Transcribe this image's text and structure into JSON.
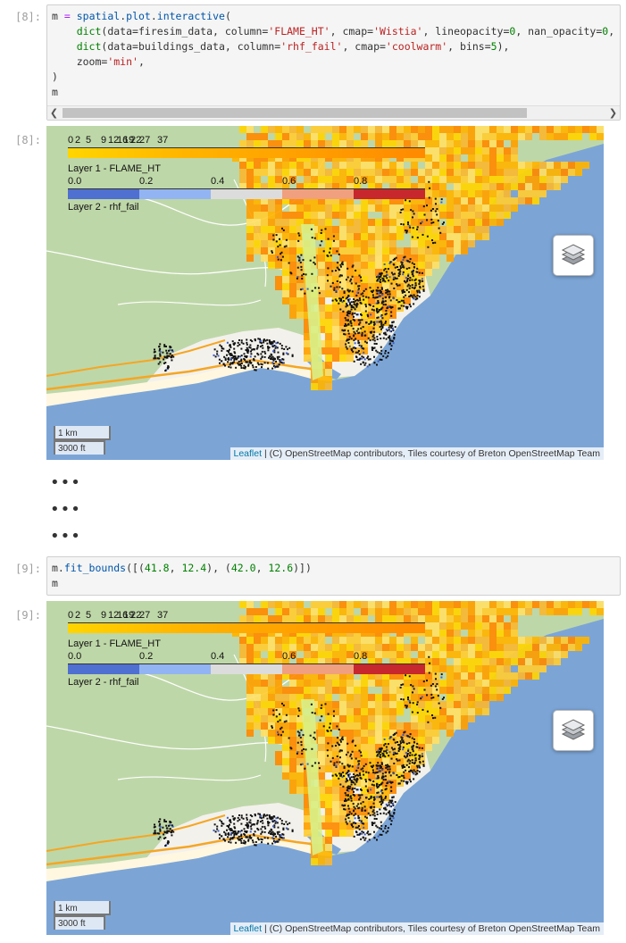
{
  "cell1": {
    "in_prompt": "[8]:",
    "out_prompt": "[8]:",
    "code_lines": [
      "m = spatial.plot.interactive(",
      "    dict(data=firesim_data, column='FLAME_HT', cmap='Wistia', lineopacity=0, nan_opacity=0,",
      "    dict(data=buildings_data, column='rhf_fail', cmap='coolwarm', bins=5),",
      "    zoom='min',",
      ")",
      "m"
    ]
  },
  "ellipsis": [
    "•••",
    "•••",
    "•••"
  ],
  "cell2": {
    "in_prompt": "[9]:",
    "out_prompt": "[9]:",
    "code_lines": [
      "m.fit_bounds([(41.8, 12.4), (42.0, 12.6)])",
      "m"
    ]
  },
  "map": {
    "legend1": {
      "ticks": [
        "0",
        "2",
        "5",
        "9",
        "12",
        "16",
        "19",
        "22",
        "27",
        "37"
      ],
      "label": "Layer 1 - FLAME_HT",
      "colors": [
        "#ffd500",
        "#ffb400",
        "#ff9f00",
        "#ff8a00"
      ]
    },
    "legend2": {
      "ticks": [
        "0.0",
        "0.2",
        "0.4",
        "0.6",
        "0.8"
      ],
      "label": "Layer 2 - rhf_fail",
      "colors": [
        "#4f6fd1",
        "#93b4f2",
        "#dcdcdc",
        "#f0a07f",
        "#c6282d"
      ]
    },
    "scale_km": "1 km",
    "scale_ft": "3000 ft",
    "attribution_link": "Leaflet",
    "attribution_text": " | (C) OpenStreetMap contributors, Tiles courtesy of Breton OpenStreetMap Team",
    "layers_icon": "layers-icon",
    "colors": {
      "sea": "#7ca5d6",
      "land": "#bed7a8",
      "urban": "#f3f1ec"
    }
  }
}
